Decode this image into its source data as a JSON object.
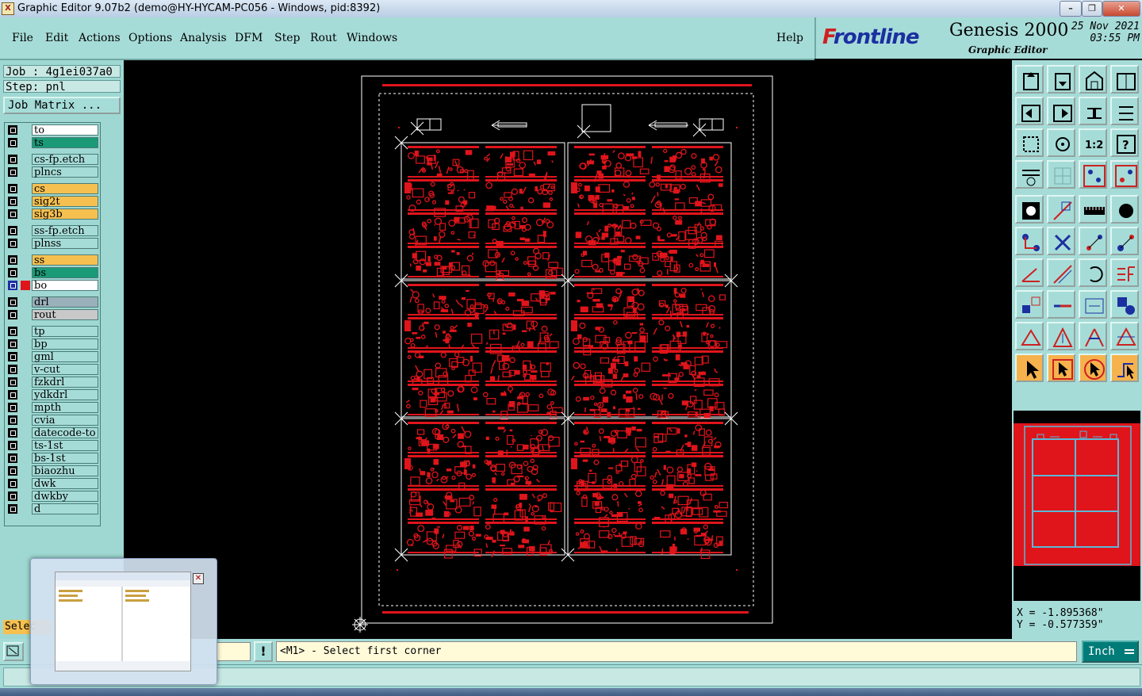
{
  "window": {
    "title": "Graphic Editor 9.07b2 (demo@HY-HYCAM-PC056 - Windows, pid:8392)",
    "buttons": [
      "–",
      "❐",
      "✕"
    ]
  },
  "menu": {
    "items": [
      "File",
      "Edit",
      "Actions",
      "Options",
      "Analysis",
      "DFM",
      "Step",
      "Rout",
      "Windows"
    ],
    "help": "Help"
  },
  "brand": {
    "logo_prefix": "F",
    "logo_rest": "rontline",
    "product": "Genesis 2000",
    "subtitle": "Graphic Editor",
    "date": "25 Nov 2021",
    "time": "03:55 PM"
  },
  "job": {
    "job_label": "Job : 4g1ei037a0",
    "step_label": "Step: pnl",
    "job_matrix_button": "Job Matrix ..."
  },
  "layers": [
    {
      "name": "to",
      "color": "#ffffff"
    },
    {
      "name": "ts",
      "color": "#1b9a78"
    },
    {
      "name": "cs-fp.etch",
      "color": "#a6dcd8"
    },
    {
      "name": "plncs",
      "color": "#a6dcd8"
    },
    {
      "name": "cs",
      "color": "#f6c050"
    },
    {
      "name": "sig2t",
      "color": "#f6c050"
    },
    {
      "name": "sig3b",
      "color": "#f6c050"
    },
    {
      "name": "ss-fp.etch",
      "color": "#a6dcd8"
    },
    {
      "name": "plnss",
      "color": "#a6dcd8"
    },
    {
      "name": "ss",
      "color": "#f6c050"
    },
    {
      "name": "bs",
      "color": "#1b9a78"
    },
    {
      "name": "bo",
      "color": "#ffffff",
      "active": true
    },
    {
      "name": "drl",
      "color": "#9ab0ba"
    },
    {
      "name": "rout",
      "color": "#c8c8c8"
    },
    {
      "name": "tp",
      "color": "#a6dcd8"
    },
    {
      "name": "bp",
      "color": "#a6dcd8"
    },
    {
      "name": "gml",
      "color": "#a6dcd8"
    },
    {
      "name": "v-cut",
      "color": "#a6dcd8"
    },
    {
      "name": "fzkdrl",
      "color": "#a6dcd8"
    },
    {
      "name": "ydkdrl",
      "color": "#a6dcd8"
    },
    {
      "name": "mpth",
      "color": "#a6dcd8"
    },
    {
      "name": "cvia",
      "color": "#a6dcd8"
    },
    {
      "name": "datecode-to",
      "color": "#a6dcd8"
    },
    {
      "name": "ts-1st",
      "color": "#a6dcd8"
    },
    {
      "name": "bs-1st",
      "color": "#a6dcd8"
    },
    {
      "name": "biaozhu",
      "color": "#a6dcd8"
    },
    {
      "name": "dwk",
      "color": "#a6dcd8"
    },
    {
      "name": "dwkby",
      "color": "#a6dcd8"
    },
    {
      "name": "d",
      "color": "#a6dcd8"
    }
  ],
  "toolbox_icons": [
    "zoom-home-icon",
    "zoom-in-icon",
    "zoom-out-icon",
    "fit-window-icon",
    "zoom-previous-icon",
    "zoom-next-icon",
    "swap-icon",
    "redraw-icon",
    "zoom-area-icon",
    "center-icon",
    "one-to-one-icon",
    "query-icon",
    "properties-icon",
    "grid-icon",
    "snap-icon",
    "snap-settings-icon",
    "pad-icon",
    "line-icon",
    "ruler-icon",
    "circle-icon",
    "nodes-icon",
    "cross-icon",
    "distance-icon",
    "connect-icon",
    "angle-icon",
    "slash-icon",
    "arc-icon",
    "fence-icon",
    "move-icon",
    "line-cut-icon",
    "measure-icon",
    "objects-icon",
    "triangle-red-icon",
    "triangle-blue-icon",
    "triangle-up-icon",
    "triangle-right-icon",
    "pointer-icon",
    "select-pointer-icon",
    "circle-pointer-icon",
    "route-pointer-icon"
  ],
  "coords": {
    "x": "X = -1.895368\"",
    "y": "Y = -0.577359\""
  },
  "prompt": "<M1> - Select first corner",
  "unit": "Inch",
  "select_label": "Selec",
  "colors": {
    "panel": "#a6dcd8",
    "feature_red": "#e0141b",
    "active_tool": "#f6b24c"
  }
}
